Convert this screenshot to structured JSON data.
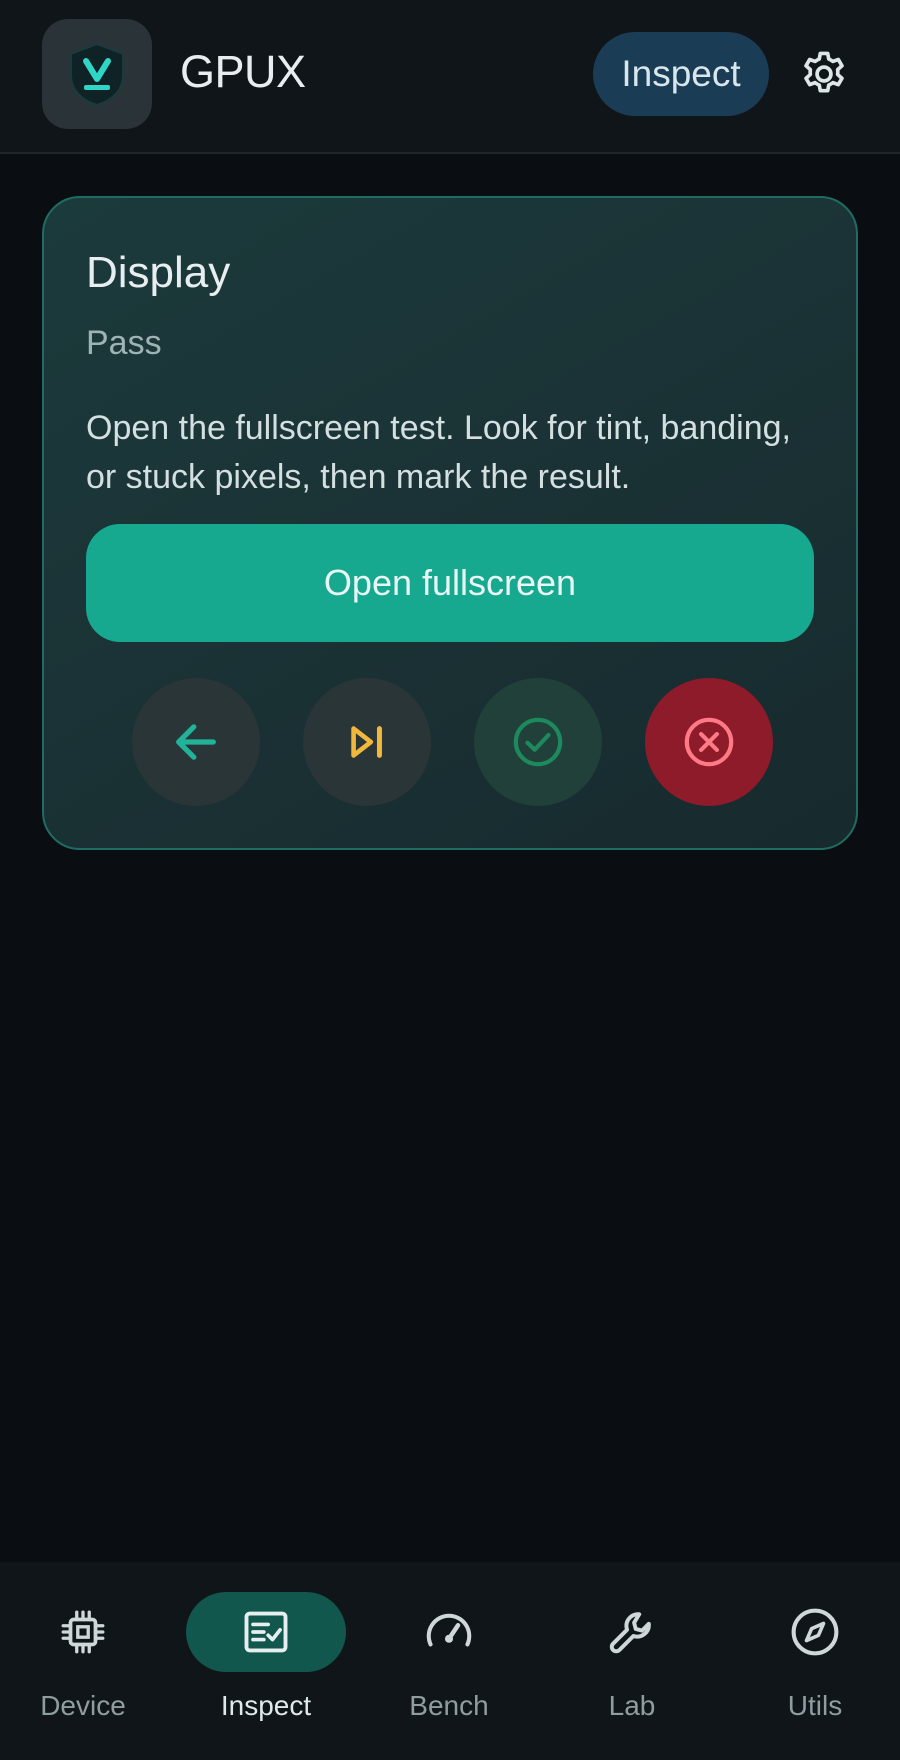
{
  "header": {
    "app_title": "GPUX",
    "inspect_label": "Inspect",
    "logo_icon": "shield-download-icon",
    "settings_icon": "gear-icon"
  },
  "card": {
    "title": "Display",
    "status": "Pass",
    "description": "Open the fullscreen test. Look for tint, banding, or stuck pixels, then mark the result.",
    "open_button_label": "Open fullscreen",
    "actions": [
      {
        "icon": "arrow-left-icon",
        "color": "#20b39a"
      },
      {
        "icon": "skip-next-icon",
        "color": "#f2b83c"
      },
      {
        "icon": "check-circle-icon",
        "color": "#1c8a5e"
      },
      {
        "icon": "close-circle-icon",
        "color": "#ff7a86"
      }
    ],
    "border_color": "#1f6c63"
  },
  "nav": {
    "items": [
      {
        "label": "Device",
        "icon": "chip-icon",
        "active": false
      },
      {
        "label": "Inspect",
        "icon": "checklist-icon",
        "active": true
      },
      {
        "label": "Bench",
        "icon": "speedometer-icon",
        "active": false
      },
      {
        "label": "Lab",
        "icon": "wrench-icon",
        "active": false
      },
      {
        "label": "Utils",
        "icon": "compass-icon",
        "active": false
      }
    ]
  },
  "colors": {
    "accent": "#17a990",
    "background": "#0a0e12",
    "fail": "#8e1b2a"
  }
}
